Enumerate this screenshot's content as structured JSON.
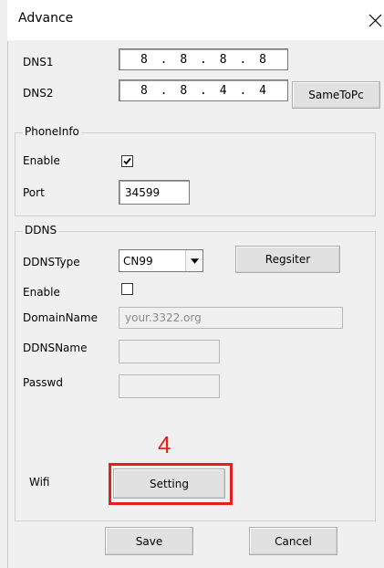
{
  "window": {
    "title": "Advance"
  },
  "dns": {
    "dns1_label": "DNS1",
    "dns1_octets": [
      "8",
      "8",
      "8",
      "8"
    ],
    "dns2_label": "DNS2",
    "dns2_octets": [
      "8",
      "8",
      "4",
      "4"
    ],
    "same_to_pc_label": "SameToPc"
  },
  "phoneinfo": {
    "group_label": "PhoneInfo",
    "enable_label": "Enable",
    "enable_checked": true,
    "port_label": "Port",
    "port_value": "34599"
  },
  "ddns": {
    "group_label": "DDNS",
    "type_label": "DDNSType",
    "type_value": "CN99",
    "register_label": "Regsiter",
    "enable_label": "Enable",
    "enable_checked": false,
    "domain_label": "DomainName",
    "domain_placeholder": "your.3322.org",
    "ddnsname_label": "DDNSName",
    "ddnsname_value": "",
    "passwd_label": "Passwd",
    "passwd_value": ""
  },
  "wifi": {
    "label": "Wifi",
    "setting_label": "Setting",
    "annotation_number": "4",
    "annotation_color": "#e3211c"
  },
  "footer": {
    "save_label": "Save",
    "cancel_label": "Cancel"
  },
  "icons": {
    "close": "close-icon",
    "check": "checkmark-icon",
    "dropdown": "chevron-down-icon"
  }
}
